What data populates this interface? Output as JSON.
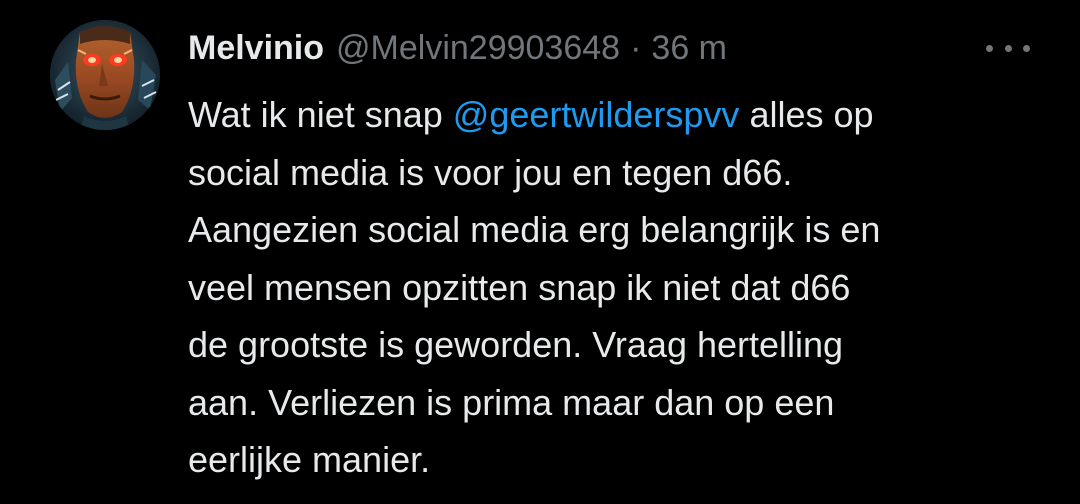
{
  "tweet": {
    "display_name": "Melvinio",
    "handle": "@Melvin29903648",
    "separator": "·",
    "time": "36 m",
    "more_icon": "more-horizontal-icon",
    "avatar_icon": "avatar-image",
    "text": {
      "line1_before": "Wat ik niet snap ",
      "mention": "@geertwilderspvv",
      "line1_after": " alles op",
      "line2": "social media is voor jou en tegen d66.",
      "line3": "Aangezien social media erg belangrijk is en",
      "line4": "veel mensen opzitten snap ik niet dat d66",
      "line5": "de grootste is geworden. Vraag hertelling",
      "line6": "aan. Verliezen is prima maar dan op een",
      "line7": "eerlijke manier."
    }
  },
  "colors": {
    "background": "#000000",
    "primary_text": "#e7e9ea",
    "secondary_text": "#71767b",
    "link": "#1d9bf0"
  }
}
